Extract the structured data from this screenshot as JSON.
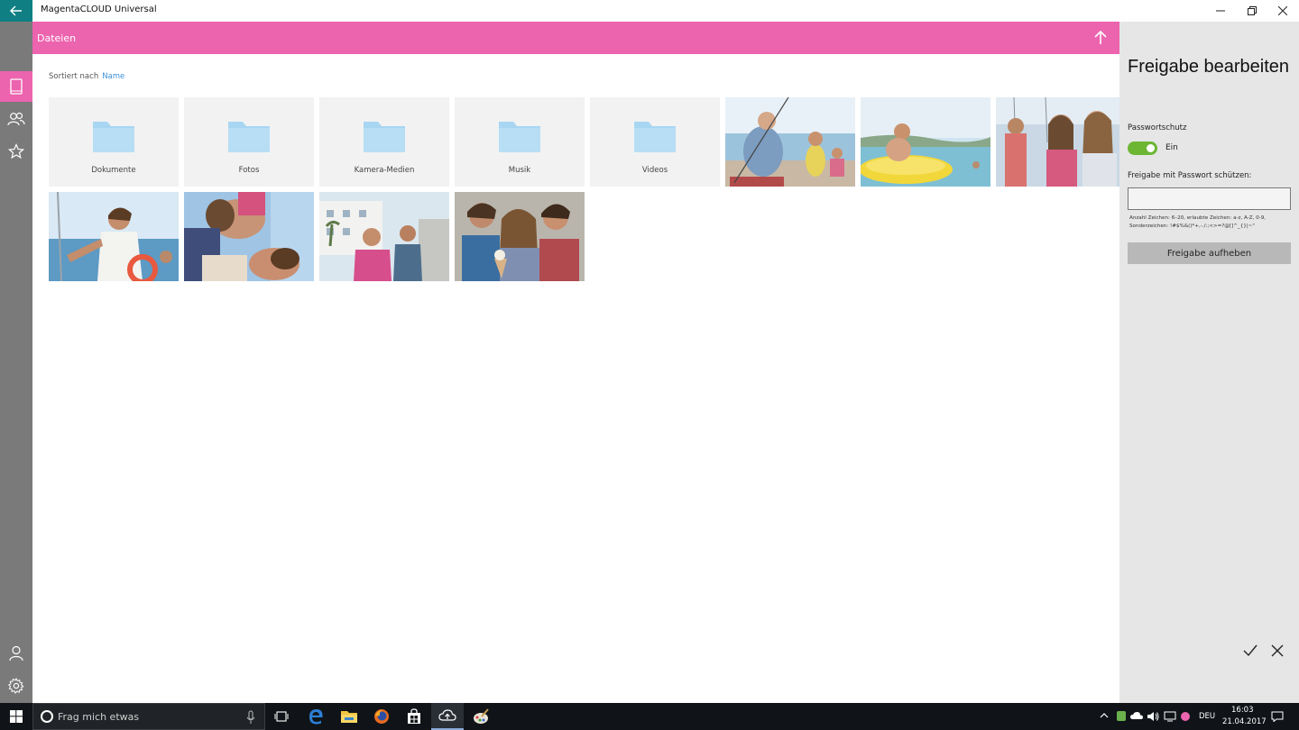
{
  "window": {
    "title": "MagentaCLOUD Universal"
  },
  "header": {
    "title": "Dateien"
  },
  "sort": {
    "label": "Sortiert nach",
    "value": "Name"
  },
  "folders": [
    {
      "label": "Dokumente"
    },
    {
      "label": "Fotos"
    },
    {
      "label": "Kamera-Medien"
    },
    {
      "label": "Musik"
    },
    {
      "label": "Videos"
    }
  ],
  "panel": {
    "title": "Freigabe bearbeiten",
    "password_label": "Passwortschutz",
    "toggle_state": "Ein",
    "field_label": "Freigabe mit Passwort schützen:",
    "field_value": "",
    "hint": "Anzahl Zeichen: 6–20, erlaubte Zeichen: a-z, A-Z, 0-9, Sonderzeichen: !#$%&()*+,-./:;<>=?@[]^_{}|~\"",
    "unshare_button": "Freigabe aufheben"
  },
  "taskbar": {
    "search_placeholder": "Frag mich etwas",
    "language": "DEU",
    "time": "16:03",
    "date": "21.04.2017"
  },
  "colors": {
    "accent": "#ec63ae",
    "rail": "#7a7a7a",
    "back_button": "#0f7f83",
    "toggle_on": "#6cb633",
    "folder_icon": "#a8d6f2"
  }
}
